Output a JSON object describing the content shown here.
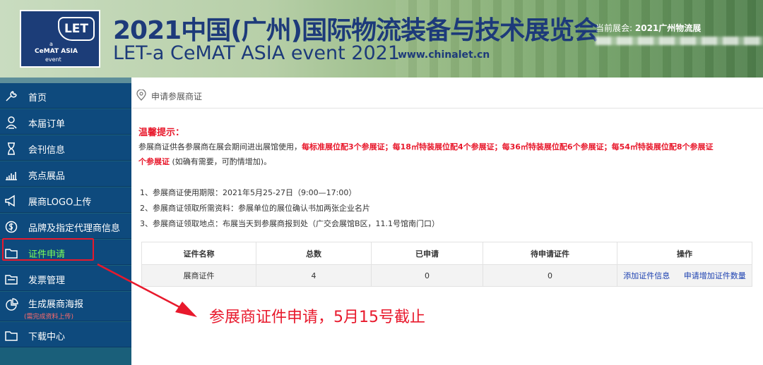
{
  "header": {
    "logo": {
      "let": "LET",
      "a": "a",
      "cemat": "CeMAT ASIA",
      "event": "event"
    },
    "title_cn": "2021中国(广州)国际物流装备与技术展览会",
    "title_en": "LET-a CeMAT ASIA event 2021",
    "url": "www.chinalet.cn",
    "current_expo_label": "当前展会:",
    "current_expo_value": "2021广州物流展"
  },
  "sidebar": {
    "items": [
      {
        "label": "首页",
        "icon": "tools-icon"
      },
      {
        "label": "本届订单",
        "icon": "user-icon"
      },
      {
        "label": "会刊信息",
        "icon": "hourglass-icon"
      },
      {
        "label": "亮点展品",
        "icon": "bar-chart-icon"
      },
      {
        "label": "展商LOGO上传",
        "icon": "megaphone-icon"
      },
      {
        "label": "品牌及指定代理商信息",
        "icon": "coin-icon"
      },
      {
        "label": "证件申请",
        "icon": "folder-icon"
      },
      {
        "label": "发票管理",
        "icon": "invoice-icon"
      },
      {
        "label": "生成展商海报",
        "sublabel": "(需完成资料上传)",
        "icon": "pie-chart-icon"
      },
      {
        "label": "下载中心",
        "icon": "folder-icon"
      }
    ],
    "active_index": 6
  },
  "breadcrumb": {
    "text": "申请参展商证",
    "icon": "location-pin-icon"
  },
  "notice": {
    "title": "温馨提示：",
    "line1_prefix": "参展商证供各参展商在展会期间进出展馆使用，",
    "line1_red": "每标准展位配3个参展证；每18㎡特装展位配4个参展证；每36㎡特装展位配6个参展证；每54㎡特装展位配8个参展证",
    "line2_red": "个参展证",
    "line2_suffix": " (如确有需要，可酌情增加)。"
  },
  "info": [
    "1、参展商证使用期限：2021年5月25-27日（9:00—17:00）",
    "2、参展商证领取所需资料：参展单位的展位确认书加两张企业名片",
    "3、参展商证领取地点：布展当天到参展商报到处（广交会展馆B区，11.1号馆南门口）"
  ],
  "table": {
    "headers": [
      "证件名称",
      "总数",
      "已申请",
      "待申请证件",
      "操作"
    ],
    "row": {
      "name": "展商证件",
      "total": "4",
      "applied": "0",
      "pending": "0"
    },
    "actions": [
      "添加证件信息",
      "申请增加证件数量"
    ]
  },
  "annotation": {
    "text": "参展商证件申请，5月15号截止",
    "color": "#e8192c"
  },
  "colors": {
    "sidebar_bg": "#0e4a7d",
    "active_text": "#7dff5a",
    "accent_red": "#e8192c",
    "title_blue": "#1d3a7a"
  }
}
